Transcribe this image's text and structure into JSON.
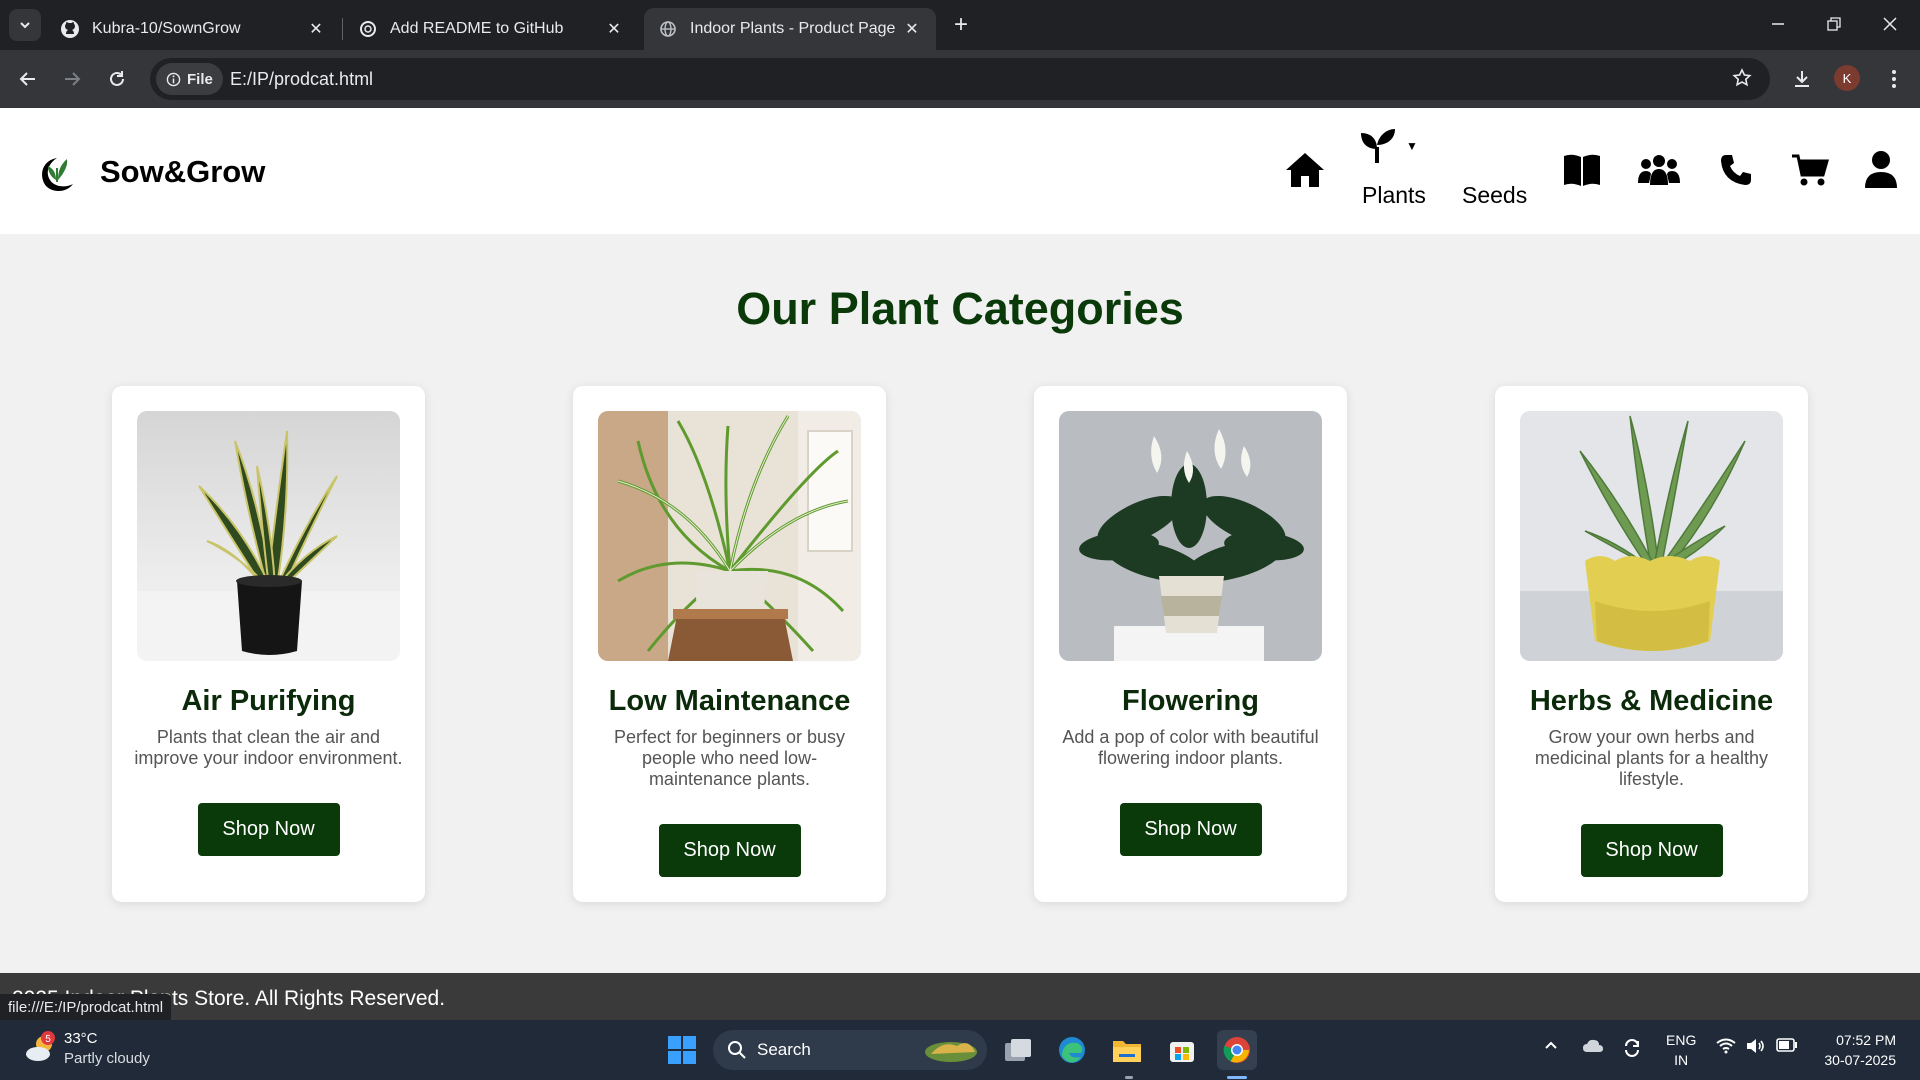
{
  "browser": {
    "tabs": [
      {
        "title": "Kubra-10/SownGrow",
        "icon": "github-icon"
      },
      {
        "title": "Add README to GitHub",
        "icon": "openai-icon"
      },
      {
        "title": "Indoor Plants - Product Page",
        "icon": "globe-icon"
      }
    ],
    "file_chip": "File",
    "url": "E:/IP/prodcat.html",
    "profile_initial": "K",
    "status_url": "file:///E:/IP/prodcat.html"
  },
  "site": {
    "brand": "Sow&Grow",
    "nav": {
      "plants": "Plants",
      "seeds": "Seeds"
    },
    "page_title": "Our Plant Categories",
    "categories": [
      {
        "name": "Air Purifying",
        "description": "Plants that clean the air and improve your indoor environment.",
        "button": "Shop Now"
      },
      {
        "name": "Low Maintenance",
        "description": "Perfect for beginners or busy people who need low-maintenance plants.",
        "button": "Shop Now"
      },
      {
        "name": "Flowering",
        "description": "Add a pop of color with beautiful flowering indoor plants.",
        "button": "Shop Now"
      },
      {
        "name": "Herbs & Medicine",
        "description": "Grow your own herbs and medicinal plants for a healthy lifestyle.",
        "button": "Shop Now"
      }
    ],
    "footer": "2025 Indoor Plants Store. All Rights Reserved."
  },
  "taskbar": {
    "weather_temp": "33°C",
    "weather_desc": "Partly cloudy",
    "weather_badge": "5",
    "search": "Search",
    "lang_top": "ENG",
    "lang_bottom": "IN",
    "time": "07:52 PM",
    "date": "30-07-2025"
  },
  "colors": {
    "brand_green": "#0a3a0a",
    "footer_bg": "#3a3a3a"
  }
}
